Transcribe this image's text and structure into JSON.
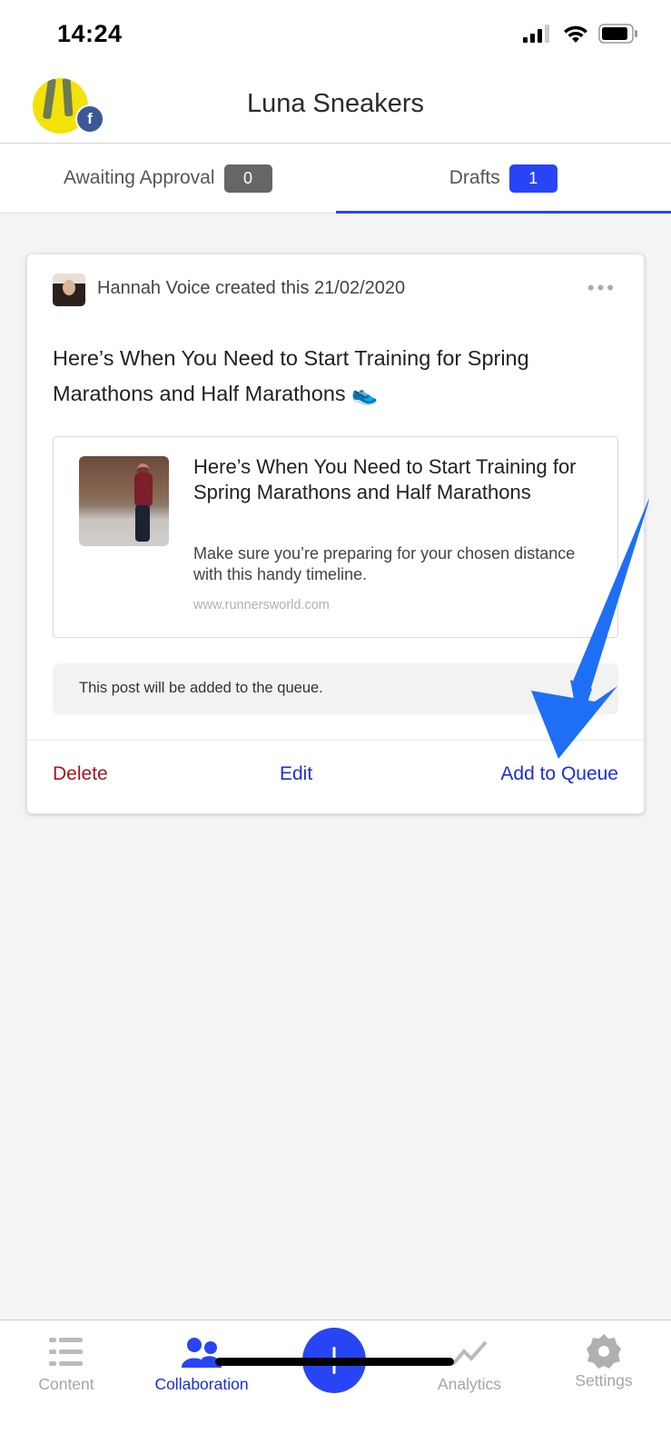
{
  "status_bar": {
    "time": "14:24"
  },
  "header": {
    "title": "Luna Sneakers",
    "network_badge": "f"
  },
  "tabs": [
    {
      "label": "Awaiting Approval",
      "count": "0",
      "active": false,
      "badge_color": "#666666"
    },
    {
      "label": "Drafts",
      "count": "1",
      "active": true,
      "badge_color": "#2845f5"
    }
  ],
  "post": {
    "meta": "Hannah Voice created this 21/02/2020",
    "more_label": "•••",
    "text": "Here’s When You Need to Start Training for Spring Marathons and Half Marathons 👟",
    "link_preview": {
      "title": "Here’s When You Need to Start Training for Spring Marathons and Half Marathons",
      "description": "Make sure you’re preparing for your chosen distance with this handy timeline.",
      "url": "www.runnersworld.com"
    },
    "queue_note": "This post will be added to the queue.",
    "actions": {
      "delete": "Delete",
      "edit": "Edit",
      "add_to_queue": "Add to Queue"
    }
  },
  "bottom_nav": {
    "items": [
      {
        "label": "Content",
        "icon": "list-icon",
        "active": false
      },
      {
        "label": "Collaboration",
        "icon": "people-icon",
        "active": true
      },
      {
        "label": "Analytics",
        "icon": "analytics-icon",
        "active": false
      },
      {
        "label": "Settings",
        "icon": "gear-icon",
        "active": false
      }
    ],
    "fab_icon": "plus-icon"
  },
  "colors": {
    "accent": "#2845f5",
    "danger": "#a8151b",
    "link": "#1a2ee0",
    "annotation_arrow": "#1e6ff5"
  }
}
